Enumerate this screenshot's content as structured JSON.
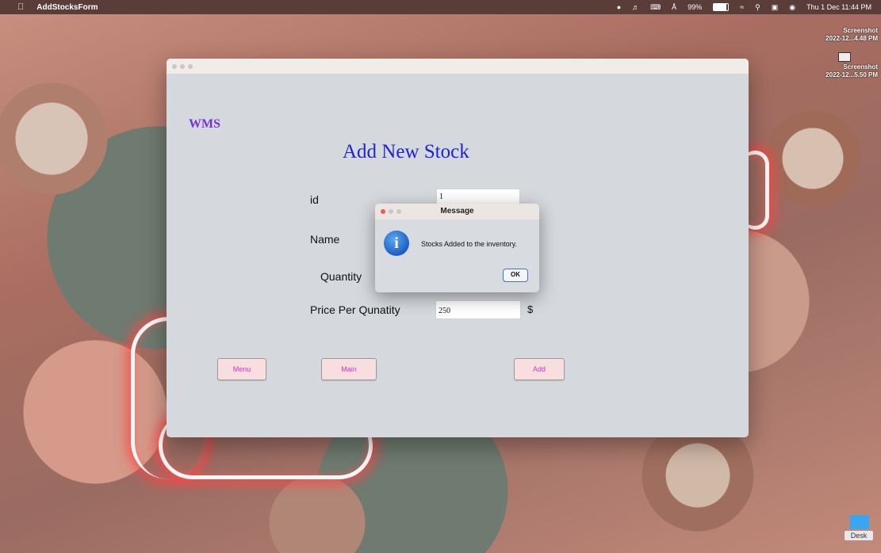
{
  "menubar": {
    "app_name": "AddStocksForm",
    "battery": "99%",
    "datetime": "Thu 1 Dec 11:44 PM"
  },
  "desktop": {
    "icons": [
      {
        "line1": "Screenshot",
        "line2": "2022-12...4.48 PM"
      },
      {
        "line1": "Screenshot",
        "line2": "2022-12...5.50 PM"
      }
    ],
    "folder_label": "Desk"
  },
  "window": {
    "brand": "WMS",
    "title": "Add New Stock",
    "fields": {
      "id": {
        "label": "id",
        "value": "1"
      },
      "name": {
        "label": "Name",
        "value": ""
      },
      "quantity": {
        "label": "Quantity",
        "value": ""
      },
      "price": {
        "label": "Price Per Qunatity",
        "value": "250"
      }
    },
    "currency": "$",
    "buttons": {
      "menu": "Menu",
      "main": "Main",
      "add": "Add"
    }
  },
  "dialog": {
    "title": "Message",
    "message": "Stocks Added to the inventory.",
    "ok": "OK"
  },
  "colors": {
    "accent_title": "#1d22d6",
    "brand": "#7a2fd8",
    "button_text": "#d232c9"
  }
}
